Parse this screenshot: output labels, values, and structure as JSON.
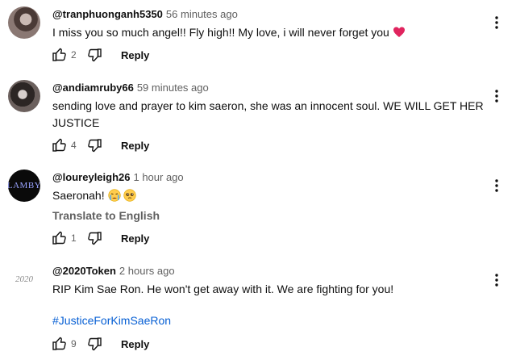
{
  "comments": [
    {
      "handle": "@tranphuonganh5350",
      "time": "56 minutes ago",
      "text": "I miss you so much angel!! Fly high!! My love, i will never forget you",
      "likes": "2",
      "reply_label": "Reply"
    },
    {
      "handle": "@andiamruby66",
      "time": "59 minutes ago",
      "text": "sending love and prayer to kim saeron, she was an innocent soul. WE WILL GET HER JUSTICE",
      "likes": "4",
      "reply_label": "Reply"
    },
    {
      "handle": "@loureyleigh26",
      "time": "1 hour ago",
      "text": "Saeronah!",
      "translate_label": "Translate to English",
      "likes": "1",
      "reply_label": "Reply",
      "avatar_text": "LAMBY"
    },
    {
      "handle": "@2020Token",
      "time": "2 hours ago",
      "text": "RIP Kim Sae Ron. He won't get away with it. We are fighting for you!",
      "hashtag": "#JusticeForKimSaeRon",
      "likes": "9",
      "reply_label": "Reply",
      "avatar_text": "2020"
    }
  ],
  "icons": {
    "like": "thumbs-up-icon",
    "dislike": "thumbs-down-icon",
    "menu": "more-vert-icon",
    "heart": "red-heart-emoji",
    "crying": "crying-face-emoji",
    "pleading": "pleading-face-emoji"
  },
  "colors": {
    "text": "#0f0f0f",
    "secondary": "#606060",
    "link": "#065fd4",
    "heart": "#e0245e"
  }
}
